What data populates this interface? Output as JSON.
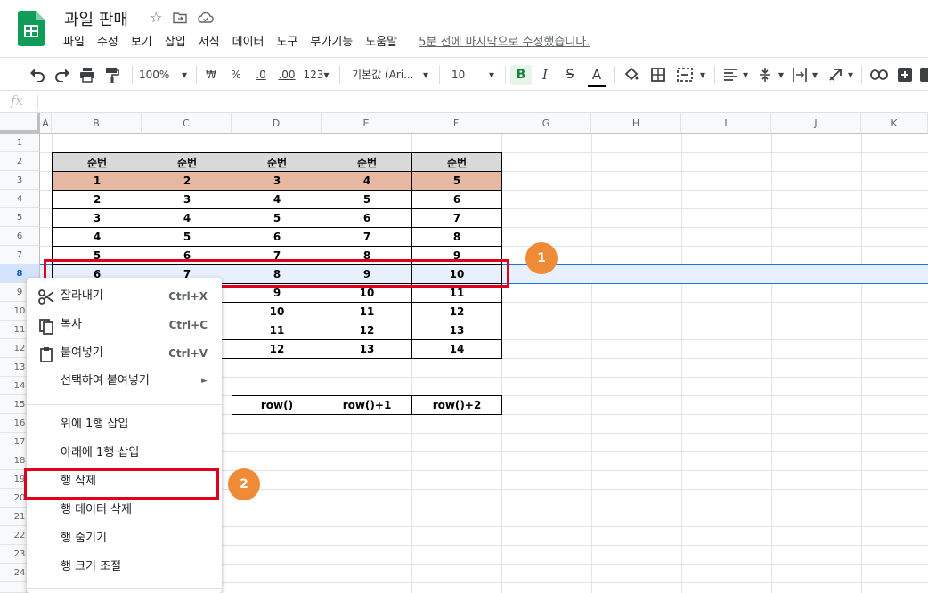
{
  "doc": {
    "title": "과일 판매",
    "last_edit": "5분 전에 마지막으로 수정했습니다."
  },
  "menubar": [
    "파일",
    "수정",
    "보기",
    "삽입",
    "서식",
    "데이터",
    "도구",
    "부가기능",
    "도움말"
  ],
  "toolbar": {
    "zoom": "100%",
    "currency": "₩",
    "percent": "%",
    "dec_decrease": ".0",
    "dec_increase": ".00",
    "format_more": "123",
    "font": "기본값 (Ari...",
    "font_size": "10",
    "bold": "B",
    "italic": "I",
    "strike": "S",
    "text_color": "A"
  },
  "formula_bar": {
    "fx": "fx"
  },
  "columns": [
    "A",
    "B",
    "C",
    "D",
    "E",
    "F",
    "G",
    "H",
    "I",
    "J",
    "K"
  ],
  "rows": [
    "1",
    "2",
    "3",
    "4",
    "5",
    "6",
    "7",
    "8",
    "9",
    "10",
    "11",
    "12",
    "13",
    "14",
    "15",
    "16",
    "17",
    "18",
    "19",
    "20",
    "21",
    "22",
    "23",
    "24"
  ],
  "table": {
    "header": [
      "순번",
      "순번",
      "순번",
      "순번",
      "순번"
    ],
    "rows": [
      [
        "1",
        "2",
        "3",
        "4",
        "5"
      ],
      [
        "2",
        "3",
        "4",
        "5",
        "6"
      ],
      [
        "3",
        "4",
        "5",
        "6",
        "7"
      ],
      [
        "4",
        "5",
        "6",
        "7",
        "8"
      ],
      [
        "5",
        "6",
        "7",
        "8",
        "9"
      ],
      [
        "6",
        "7",
        "8",
        "9",
        "10"
      ],
      [
        "",
        "",
        "9",
        "10",
        "11"
      ],
      [
        "",
        "",
        "10",
        "11",
        "12"
      ],
      [
        "",
        "",
        "11",
        "12",
        "13"
      ],
      [
        "",
        "",
        "12",
        "13",
        "14"
      ]
    ],
    "formula_row": [
      "row()",
      "row()+1",
      "row()+2"
    ]
  },
  "annotations": {
    "badge1": "1",
    "badge2": "2"
  },
  "context_menu": {
    "cut": {
      "label": "잘라내기",
      "shortcut": "Ctrl+X"
    },
    "copy": {
      "label": "복사",
      "shortcut": "Ctrl+C"
    },
    "paste": {
      "label": "붙여넣기",
      "shortcut": "Ctrl+V"
    },
    "paste_special": {
      "label": "선택하여 붙여넣기"
    },
    "insert_above": {
      "label": "위에 1행 삽입"
    },
    "insert_below": {
      "label": "아래에 1행 삽입"
    },
    "delete_row": {
      "label": "행 삭제"
    },
    "clear_row": {
      "label": "행 데이터 삭제"
    },
    "hide_row": {
      "label": "행 숨기기"
    },
    "resize_row": {
      "label": "행 크기 조절"
    }
  },
  "colors": {
    "accent_red": "#e0001b",
    "badge_orange": "#ef8a37",
    "sheets_green": "#0f9d58",
    "orange_row": "#e6b8a2"
  }
}
